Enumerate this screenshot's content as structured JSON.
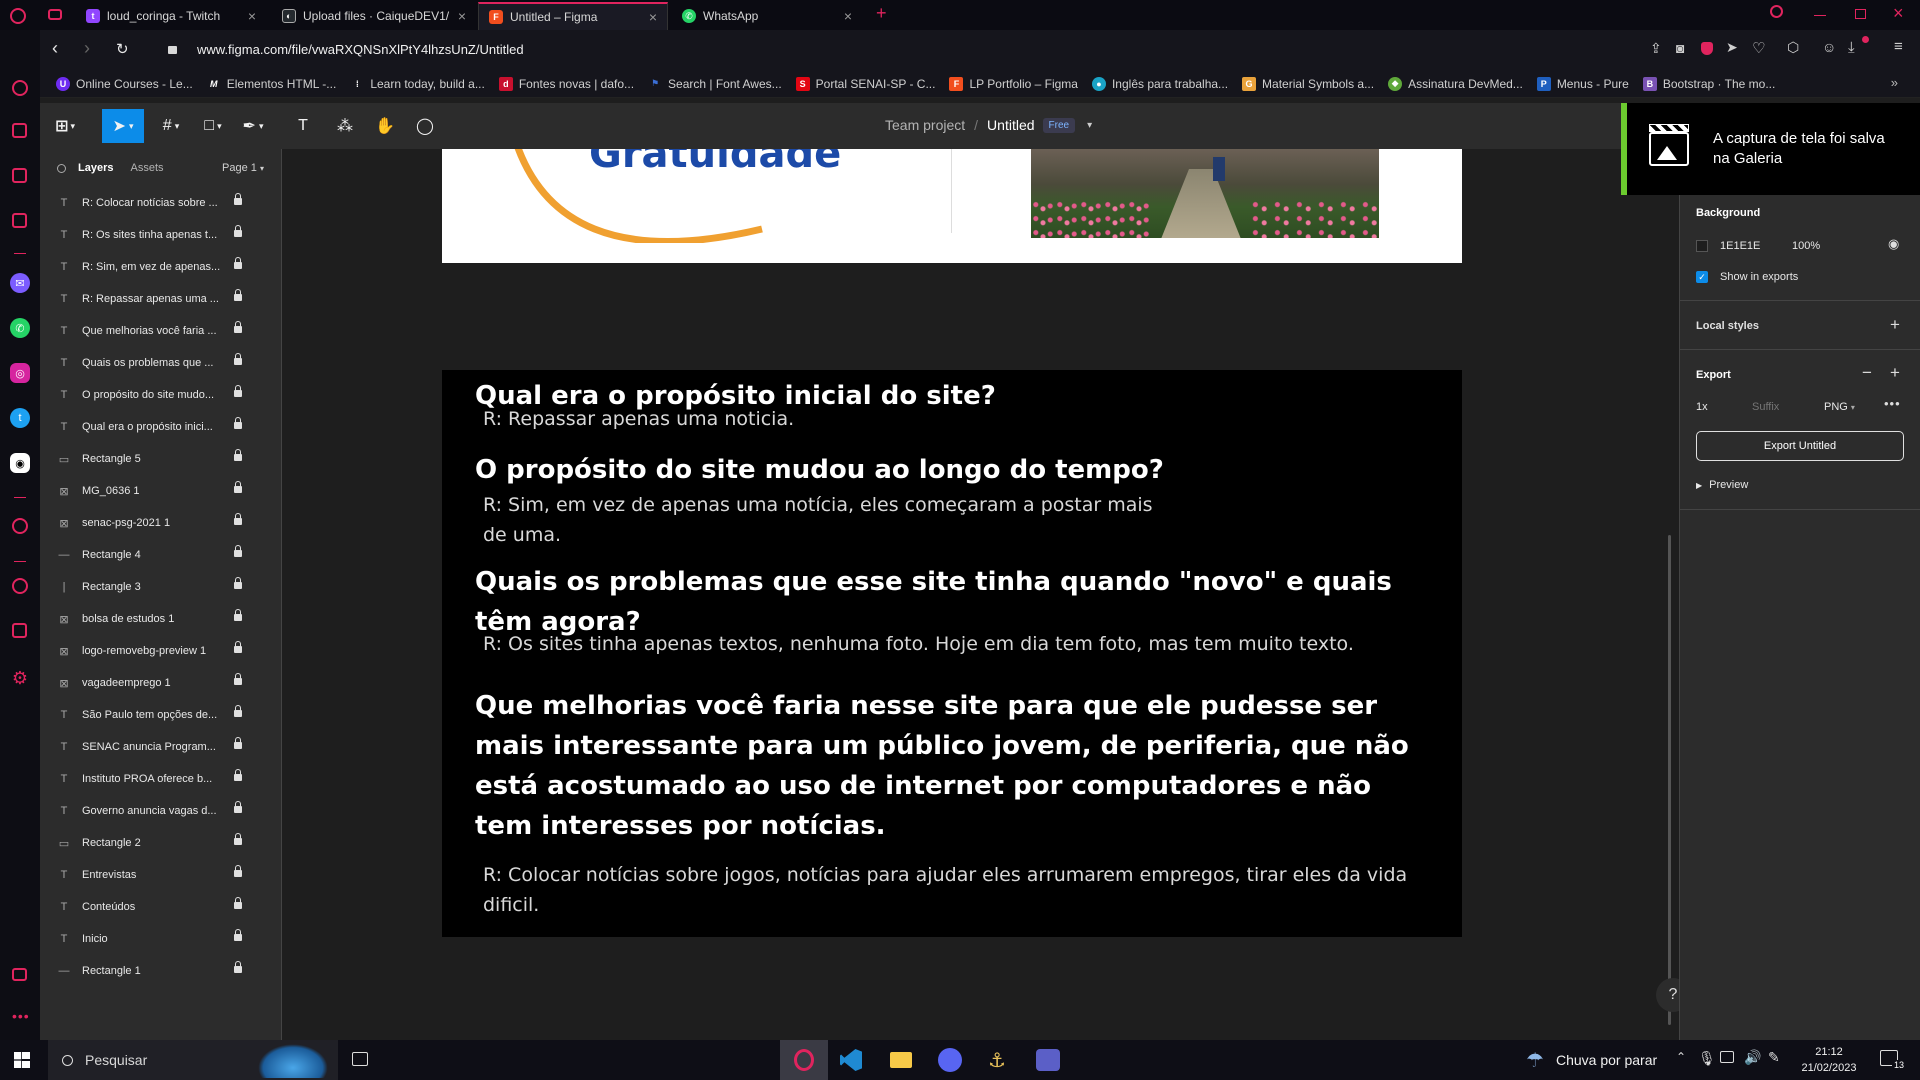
{
  "tabs": [
    {
      "label": "loud_coringa - Twitch",
      "color": "#9146ff",
      "glyph": "t"
    },
    {
      "label": "Upload files · CaiqueDEV1/",
      "color": "#24292e",
      "glyph": "◐"
    },
    {
      "label": "Untitled – Figma",
      "color": "#f24e1e",
      "glyph": "F"
    },
    {
      "label": "WhatsApp",
      "color": "#25d366",
      "glyph": "✆"
    }
  ],
  "address": {
    "url": "www.figma.com/file/vwaRXQNSnXlPtY4lhzsUnZ/Untitled"
  },
  "bookmarks": [
    {
      "label": "Online Courses - Le...",
      "color": "#6e2cf2",
      "glyph": "U"
    },
    {
      "label": "Elementos HTML -...",
      "color": "#333333",
      "glyph": "M"
    },
    {
      "label": "Learn today, build a...",
      "color": "#444444",
      "glyph": "⁞"
    },
    {
      "label": "Fontes novas | dafo...",
      "color": "#c8102e",
      "glyph": "d"
    },
    {
      "label": "Search | Font Awes...",
      "color": "#3b6fd6",
      "glyph": "⚑"
    },
    {
      "label": "Portal SENAI-SP - C...",
      "color": "#e30613",
      "glyph": "S"
    },
    {
      "label": "LP Portfolio – Figma",
      "color": "#f24e1e",
      "glyph": "F"
    },
    {
      "label": "Inglês para trabalha...",
      "color": "#1aa3c6",
      "glyph": "●"
    },
    {
      "label": "Material Symbols a...",
      "color": "#e9a23b",
      "glyph": "G"
    },
    {
      "label": "Assinatura DevMed...",
      "color": "#5fa83a",
      "glyph": "◆"
    },
    {
      "label": "Menus - Pure",
      "color": "#1f5fbf",
      "glyph": "P"
    },
    {
      "label": "Bootstrap · The mo...",
      "color": "#7952b3",
      "glyph": "B"
    }
  ],
  "figma": {
    "breadcrumb_team": "Team project",
    "breadcrumb_sep": "/",
    "file_name": "Untitled",
    "plan_badge": "Free"
  },
  "layers_panel": {
    "tab_layers": "Layers",
    "tab_assets": "Assets",
    "page": "Page 1",
    "items": [
      {
        "icon": "T",
        "name": "R: Colocar notícias sobre ..."
      },
      {
        "icon": "T",
        "name": "R: Os sites tinha apenas t..."
      },
      {
        "icon": "T",
        "name": "R: Sim, em vez de apenas..."
      },
      {
        "icon": "T",
        "name": "R: Repassar apenas uma ..."
      },
      {
        "icon": "T",
        "name": "Que melhorias você faria ..."
      },
      {
        "icon": "T",
        "name": "Quais os problemas que ..."
      },
      {
        "icon": "T",
        "name": "O propósito do site mudo..."
      },
      {
        "icon": "T",
        "name": "Qual era o propósito inici..."
      },
      {
        "icon": "▭",
        "name": "Rectangle 5"
      },
      {
        "icon": "⊠",
        "name": "MG_0636 1"
      },
      {
        "icon": "⊠",
        "name": "senac-psg-2021 1"
      },
      {
        "icon": "—",
        "name": "Rectangle 4"
      },
      {
        "icon": "|",
        "name": "Rectangle 3"
      },
      {
        "icon": "⊠",
        "name": "bolsa de estudos 1"
      },
      {
        "icon": "⊠",
        "name": "logo-removebg-preview 1"
      },
      {
        "icon": "⊠",
        "name": "vagadeemprego 1"
      },
      {
        "icon": "T",
        "name": "São Paulo tem opções de..."
      },
      {
        "icon": "T",
        "name": "SENAC anuncia Program..."
      },
      {
        "icon": "T",
        "name": "Instituto PROA oferece b..."
      },
      {
        "icon": "T",
        "name": "Governo anuncia vagas d..."
      },
      {
        "icon": "▭",
        "name": "Rectangle 2"
      },
      {
        "icon": "T",
        "name": "Entrevistas"
      },
      {
        "icon": "T",
        "name": "Conteúdos"
      },
      {
        "icon": "T",
        "name": "Inicio"
      },
      {
        "icon": "—",
        "name": "Rectangle 1"
      }
    ]
  },
  "canvas": {
    "top_frame_text": "Gratuidade",
    "q1": "Qual era o propósito inicial do site?",
    "a1": "R: Repassar apenas uma noticia.",
    "q2": "O propósito do site mudou ao longo do tempo?",
    "a2": "R: Sim, em vez de apenas uma notícia, eles começaram a postar mais de uma.",
    "q3": "Quais os problemas que esse site tinha quando \"novo\" e quais têm agora?",
    "a3": "R: Os sites tinha apenas textos, nenhuma foto. Hoje em dia tem foto, mas tem muito texto.",
    "q4": "Que melhorias você faria nesse site para que ele pudesse ser mais interessante para um público jovem, de periferia, que não está acostumado ao uso de internet por computadores e não tem interesses por notícias.",
    "a4": "R: Colocar notícias sobre jogos, notícias para ajudar eles arrumarem empregos, tirar eles da vida dificil."
  },
  "toast": {
    "message": "A captura de tela foi salva na Galeria"
  },
  "right_panel": {
    "background_title": "Background",
    "bg_hex": "1E1E1E",
    "bg_opacity": "100%",
    "show_in_exports": "Show in exports",
    "local_styles": "Local styles",
    "export_title": "Export",
    "export_scale": "1x",
    "export_suffix_placeholder": "Suffix",
    "export_format": "PNG",
    "export_button": "Export Untitled",
    "preview": "Preview",
    "help": "?"
  },
  "taskbar": {
    "search_placeholder": "Pesquisar",
    "weather": "Chuva por parar",
    "time": "21:12",
    "date": "21/02/2023",
    "notif_count": "13"
  },
  "colors": {
    "accent": "#0c8ce9",
    "opera_red": "#e0245e",
    "toast_border": "#6ccb2f"
  }
}
